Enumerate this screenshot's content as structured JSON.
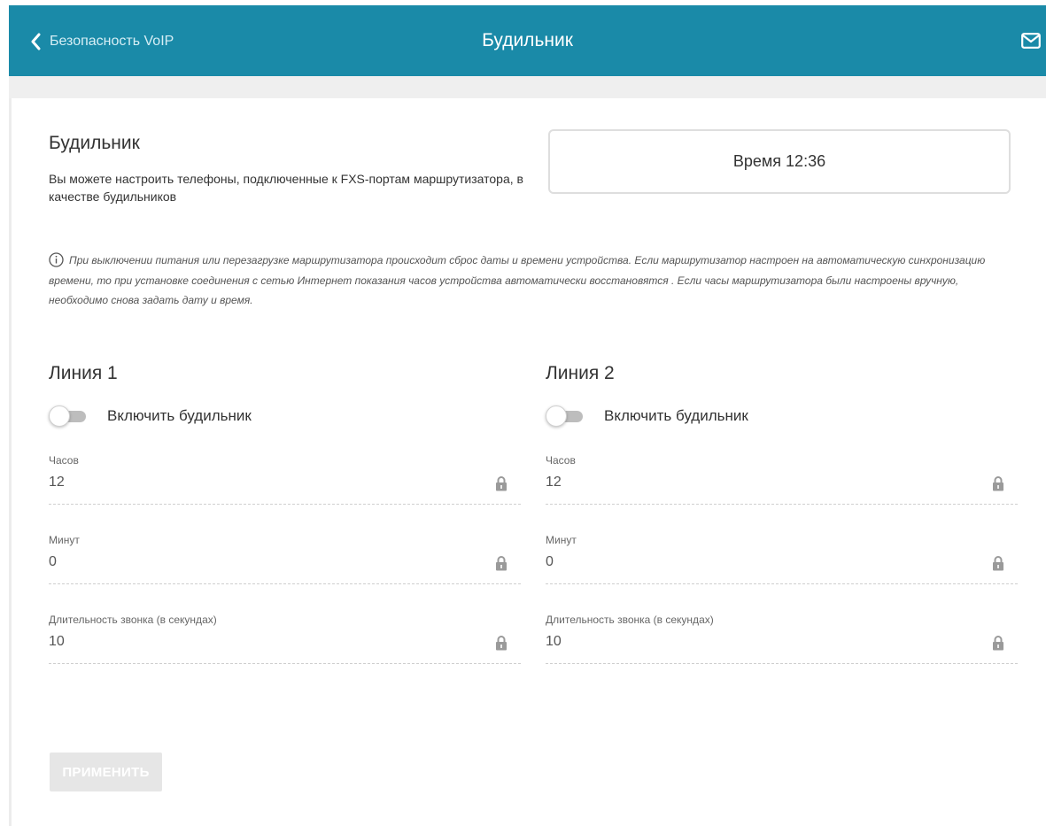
{
  "header": {
    "back_label": "Безопасность VoIP",
    "title": "Будильник",
    "color": "#1a8aa8"
  },
  "intro": {
    "title": "Будильник",
    "text": "Вы можете настроить телефоны, подключенные к FXS-портам маршрутизатора, в качестве будильников"
  },
  "time_box": {
    "text": "Время 12:36"
  },
  "note": "При выключении питания или перезагрузке маршрутизатора происходит сброс даты и времени устройства. Если маршрутизатор настроен на автоматическую синхронизацию времени, то при установке соединения с сетью Интернет показания часов устройства автоматически восстановятся . Если часы маршрутизатора были настроены вручную, необходимо снова задать дату и время.",
  "lines": [
    {
      "title": "Линия 1",
      "toggle_label": "Включить будильник",
      "enabled": false,
      "hours_label": "Часов",
      "hours_value": "12",
      "minutes_label": "Минут",
      "minutes_value": "0",
      "duration_label": "Длительность звонка (в секундах)",
      "duration_value": "10"
    },
    {
      "title": "Линия 2",
      "toggle_label": "Включить будильник",
      "enabled": false,
      "hours_label": "Часов",
      "hours_value": "12",
      "minutes_label": "Минут",
      "minutes_value": "0",
      "duration_label": "Длительность звонка (в секундах)",
      "duration_value": "10"
    }
  ],
  "apply_label": "ПРИМЕНИТЬ",
  "icons": {
    "back": "chevron-left-icon",
    "mail": "mail-icon",
    "info": "info-icon",
    "lock": "lock-icon"
  }
}
